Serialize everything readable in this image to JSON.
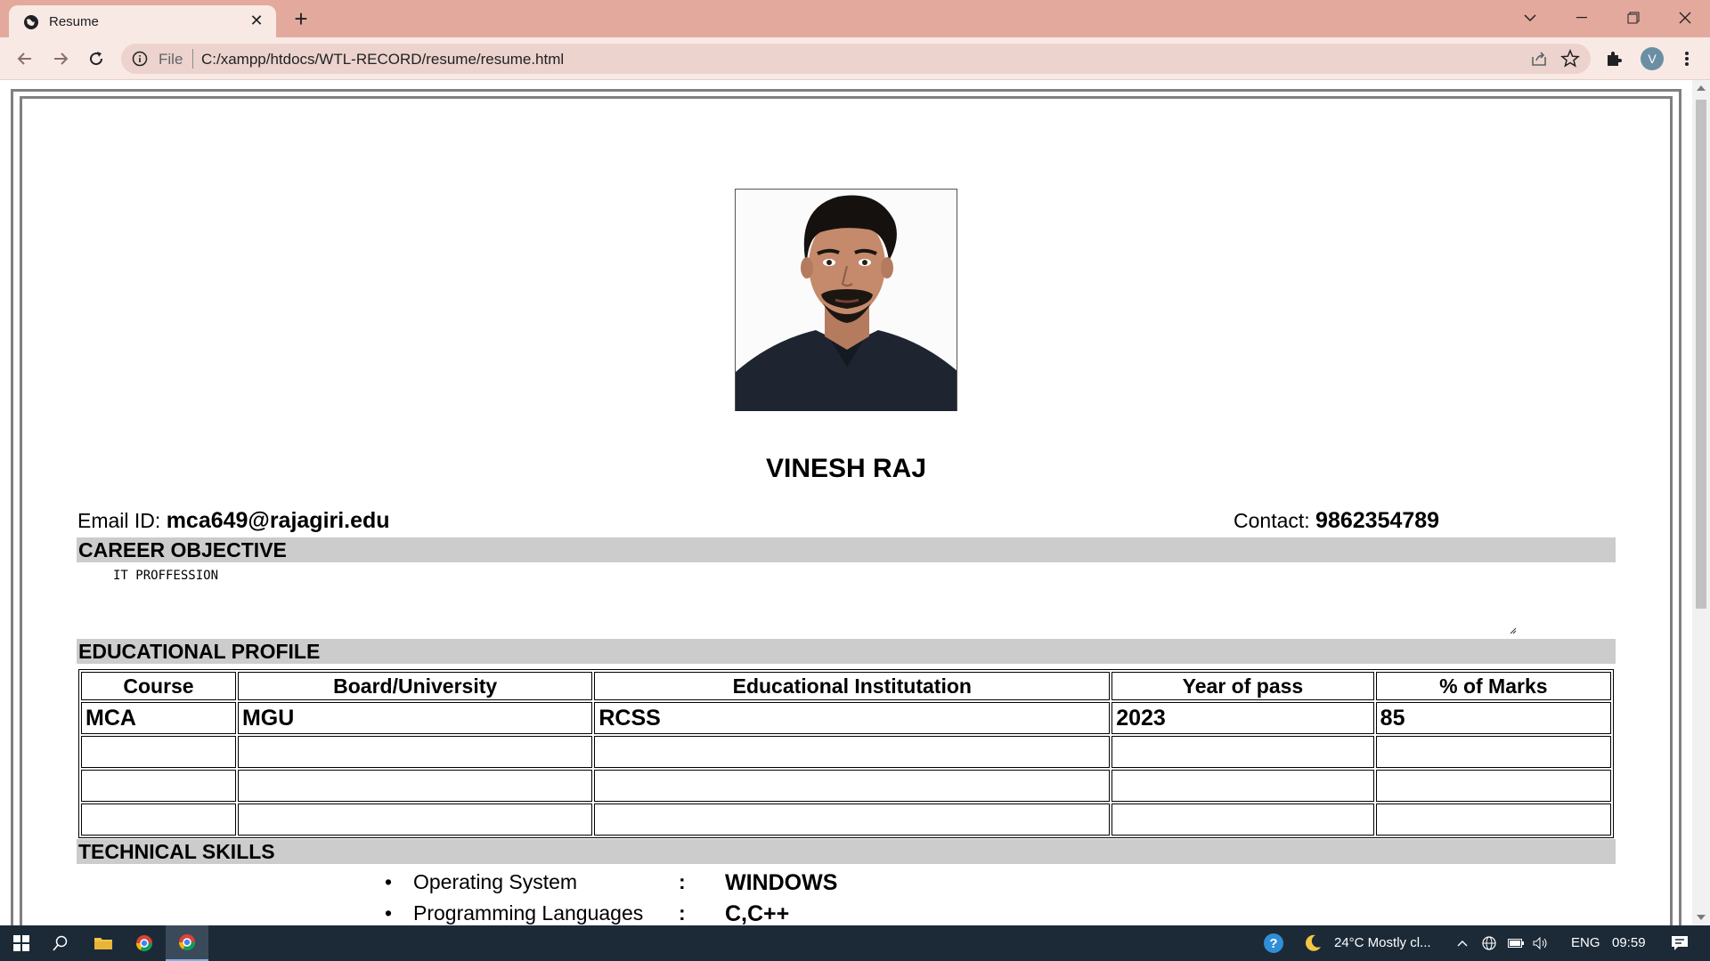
{
  "browser": {
    "tab_title": "Resume",
    "address_scheme_label": "File",
    "address_url": "C:/xampp/htdocs/WTL-RECORD/resume/resume.html",
    "profile_initial": "V"
  },
  "resume": {
    "name": "VINESH RAJ",
    "email_label": "Email ID:",
    "email_value": "mca649@rajagiri.edu",
    "contact_label": "Contact:",
    "contact_value": "9862354789",
    "sections": {
      "career_objective": "CAREER OBJECTIVE",
      "educational_profile": "EDUCATIONAL PROFILE",
      "technical_skills": "TECHNICAL SKILLS"
    },
    "career_objective_text": "IT PROFFESSION",
    "education_table": {
      "headers": [
        "Course",
        "Board/University",
        "Educational Institutation",
        "Year of pass",
        "% of Marks"
      ],
      "rows": [
        [
          "MCA",
          "MGU",
          "RCSS",
          "2023",
          "85"
        ],
        [
          "",
          "",
          "",
          "",
          ""
        ],
        [
          "",
          "",
          "",
          "",
          ""
        ],
        [
          "",
          "",
          "",
          "",
          ""
        ]
      ]
    },
    "skills": [
      {
        "label": "Operating System",
        "value": "WINDOWS"
      },
      {
        "label": "Programming Languages",
        "value": "C,C++"
      }
    ],
    "skill_separator": ":"
  },
  "taskbar": {
    "weather": "24°C  Mostly cl...",
    "language": "ENG",
    "time": "09:59"
  },
  "colors": {
    "titlebar": "#e3a99c",
    "toolbar": "#f9e9e5",
    "section_bar": "#cccccc",
    "taskbar": "#1c2a38"
  }
}
